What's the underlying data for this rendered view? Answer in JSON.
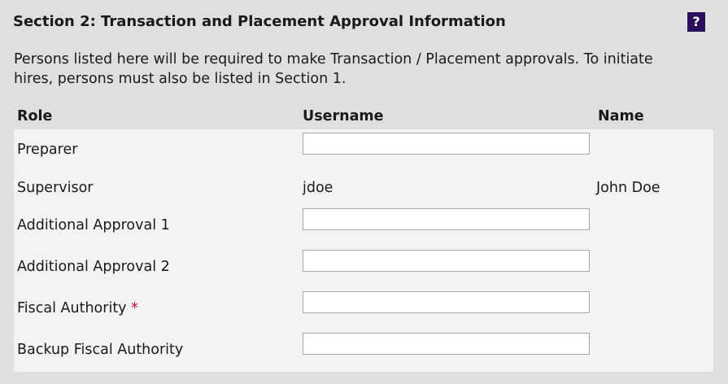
{
  "section": {
    "title": "Section 2: Transaction and Placement Approval Information",
    "help_label": "?",
    "description_line1": "Persons listed here will be required to make Transaction / Placement approvals. To initiate",
    "description_line2": "hires, persons must also be listed in Section 1."
  },
  "table": {
    "headers": {
      "role": "Role",
      "username": "Username",
      "name": "Name"
    },
    "rows": [
      {
        "role": "Preparer",
        "username_value": "",
        "name": ""
      },
      {
        "role": "Supervisor",
        "username": "jdoe",
        "name": "John Doe"
      },
      {
        "role": "Additional Approval 1",
        "username_value": "",
        "name": ""
      },
      {
        "role": "Additional Approval 2",
        "username_value": "",
        "name": ""
      },
      {
        "role": "Fiscal Authority",
        "required_marker": "*",
        "username_value": "",
        "name": ""
      },
      {
        "role": "Backup Fiscal Authority",
        "username_value": "",
        "name": ""
      }
    ]
  },
  "colors": {
    "background": "#dedfe0",
    "table_background": "#f3f3f3",
    "help_button": "#2b0f5a",
    "required_marker": "#c8102e"
  }
}
